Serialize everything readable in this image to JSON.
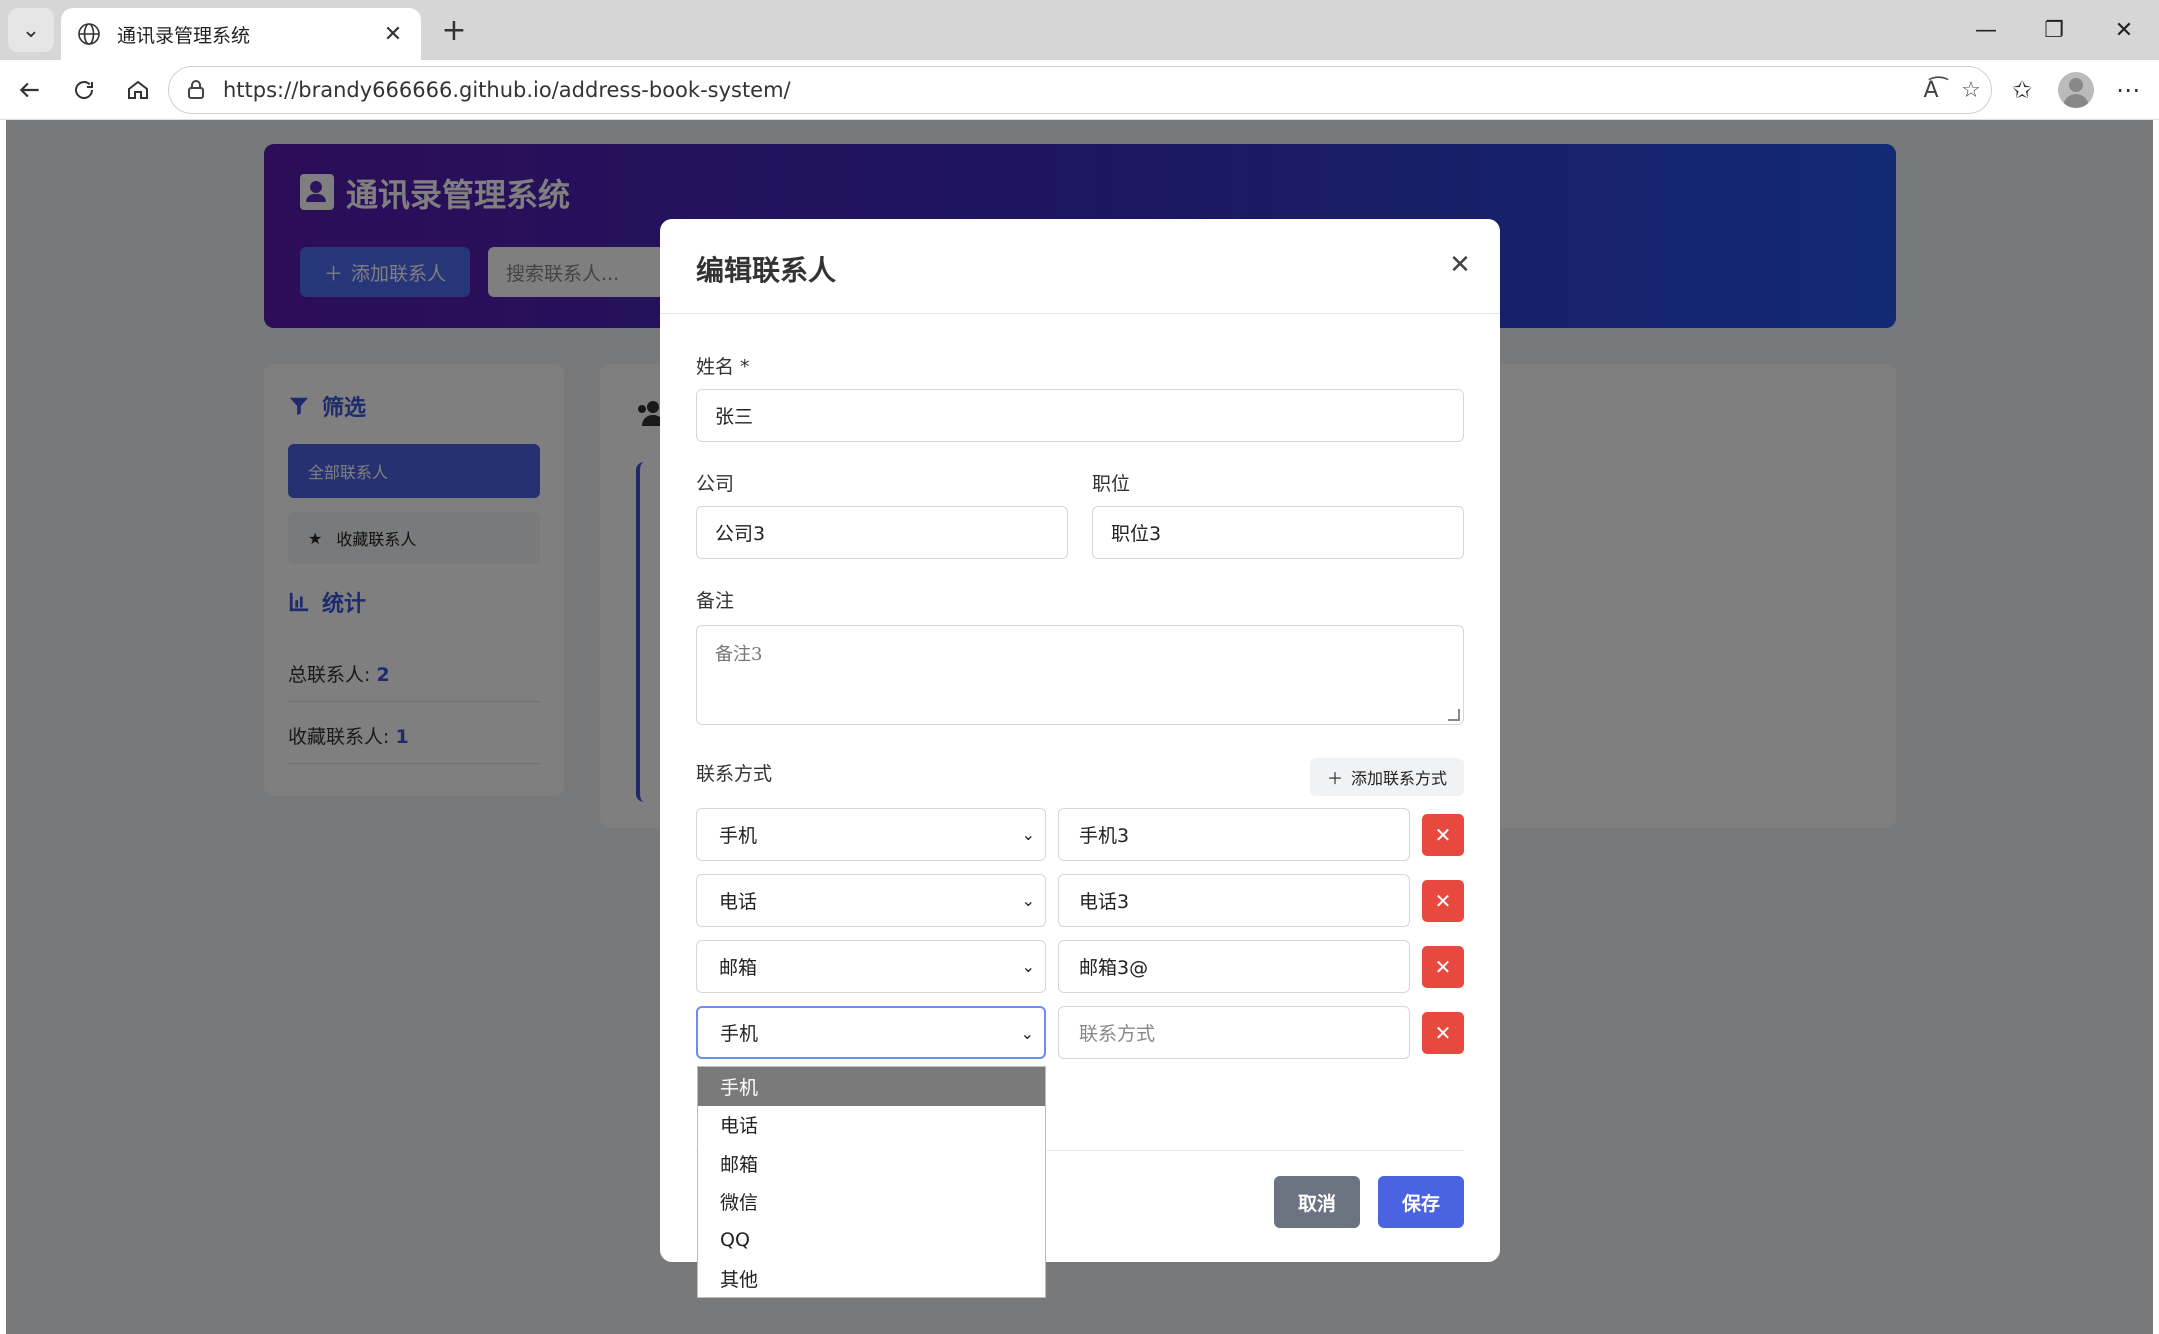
{
  "browser": {
    "tab_title": "通讯录管理系统",
    "url": "https://brandy666666.github.io/address-book-system/"
  },
  "app": {
    "title": "通讯录管理系统",
    "add_button": "添加联系人",
    "search_placeholder": "搜索联系人..."
  },
  "sidebar": {
    "filter_title": "筛选",
    "filters": [
      "全部联系人",
      "收藏联系人"
    ],
    "stats_title": "统计",
    "total_label": "总联系人: ",
    "total_value": "2",
    "fav_label": "收藏联系人: ",
    "fav_value": "1"
  },
  "modal": {
    "title": "编辑联系人",
    "name_label": "姓名 *",
    "name_value": "张三",
    "company_label": "公司",
    "company_value": "公司3",
    "position_label": "职位",
    "position_value": "职位3",
    "notes_label": "备注",
    "notes_value": "备注3",
    "contacts_label": "联系方式",
    "add_contact_button": "添加联系方式",
    "contacts": [
      {
        "type": "手机",
        "value": "手机3"
      },
      {
        "type": "电话",
        "value": "电话3"
      },
      {
        "type": "邮箱",
        "value": "邮箱3@"
      },
      {
        "type": "手机",
        "value": ""
      }
    ],
    "contact_placeholder": "联系方式",
    "cancel_button": "取消",
    "save_button": "保存"
  },
  "dropdown": {
    "options": [
      "手机",
      "电话",
      "邮箱",
      "微信",
      "QQ",
      "其他"
    ],
    "selected": "手机"
  },
  "colors": {
    "primary": "#4a63e0",
    "danger": "#e8493f",
    "header_gradient_start": "#5a1ab0",
    "header_gradient_end": "#2453e8"
  }
}
